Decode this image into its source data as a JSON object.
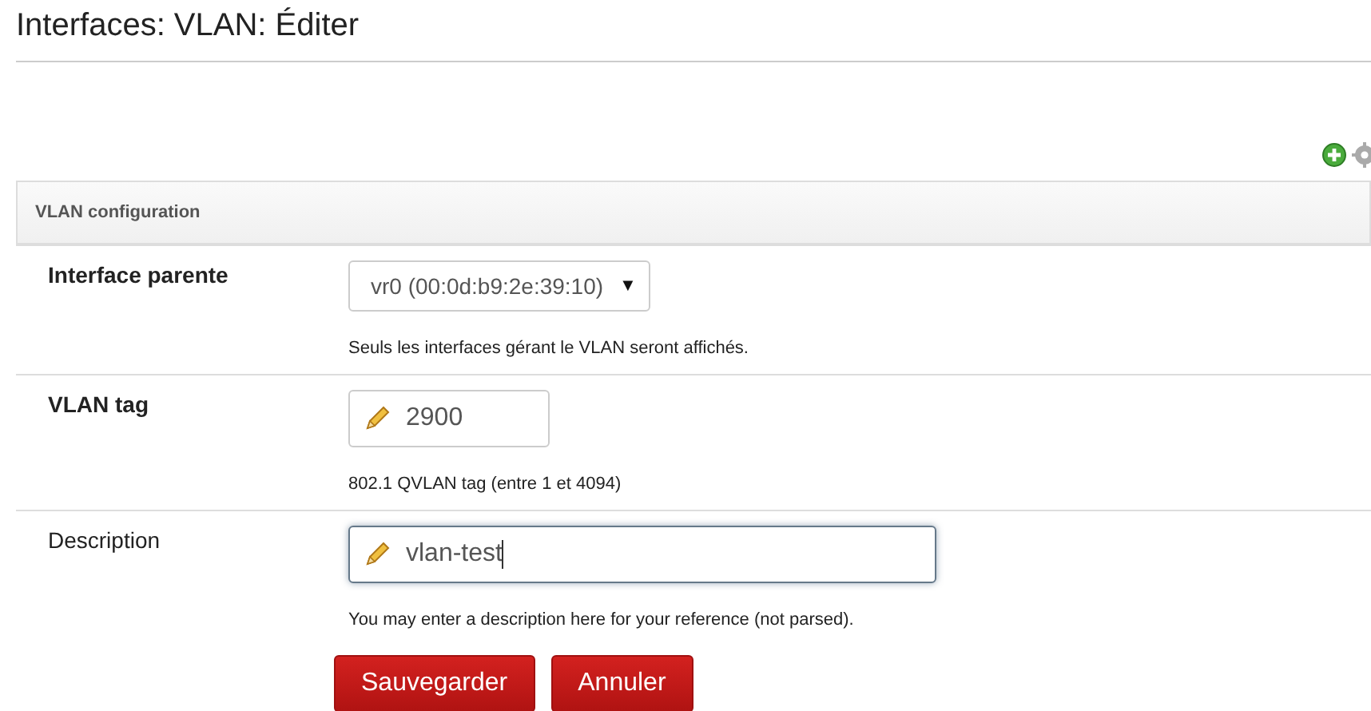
{
  "page_title": "Interfaces: VLAN: Éditer",
  "section": {
    "title": "VLAN configuration"
  },
  "fields": [
    {
      "kind": "select",
      "label": "Interface parente",
      "required": true,
      "value": "vr0 (00:0d:b9:2e:39:10)",
      "caret": "▼",
      "help": "Seuls les interfaces gérant le VLAN seront affichés."
    },
    {
      "kind": "short_text",
      "label": "VLAN tag",
      "required": true,
      "value": "2900",
      "help": "802.1 QVLAN tag (entre 1 et 4094)",
      "focused": false
    },
    {
      "kind": "text",
      "label": "Description",
      "required": false,
      "value": "vlan-test",
      "help": "You may enter a description here for your reference (not parsed).",
      "focused": true
    }
  ],
  "buttons": [
    "Sauvegarder",
    "Annuler"
  ]
}
